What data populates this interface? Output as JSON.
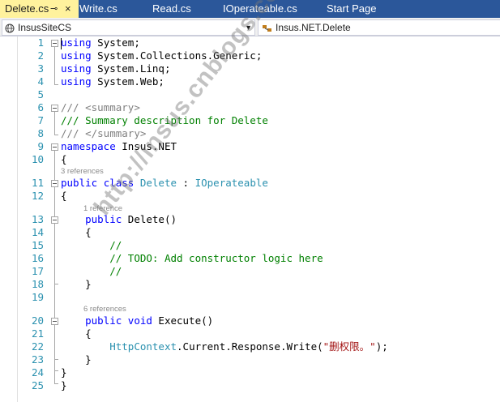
{
  "tabs": [
    {
      "label": "Delete.cs",
      "active": true,
      "pin": "⊸",
      "close": "×"
    },
    {
      "label": "Write.cs"
    },
    {
      "label": "Read.cs"
    },
    {
      "label": "IOperateable.cs"
    },
    {
      "label": "Start Page"
    }
  ],
  "nav": {
    "project": "InsusSiteCS",
    "type": "Insus.NET.Delete"
  },
  "colors": {
    "keyword": "#0000ff",
    "comment": "#008000",
    "type": "#2b91af",
    "string": "#a31515",
    "linenumber": "#2b91af",
    "accent_tab": "#2b579a",
    "active_tab": "#fff29d"
  },
  "lens": {
    "class_refs": "3 references",
    "ctor_refs": "1 reference",
    "method_refs": "6 references"
  },
  "lines": [
    {
      "n": "1",
      "indent": "",
      "tokens": [
        {
          "t": "using",
          "c": "kw"
        },
        {
          "t": " System;",
          "c": "plain"
        }
      ]
    },
    {
      "n": "2",
      "indent": "",
      "tokens": [
        {
          "t": "using",
          "c": "kw"
        },
        {
          "t": " System.Collections.Generic;",
          "c": "plain"
        }
      ]
    },
    {
      "n": "3",
      "indent": "",
      "tokens": [
        {
          "t": "using",
          "c": "kw"
        },
        {
          "t": " System.Linq;",
          "c": "plain"
        }
      ]
    },
    {
      "n": "4",
      "indent": "",
      "tokens": [
        {
          "t": "using",
          "c": "kw"
        },
        {
          "t": " System.Web;",
          "c": "plain"
        }
      ]
    },
    {
      "n": "5",
      "indent": "",
      "tokens": []
    },
    {
      "n": "6",
      "indent": "",
      "tokens": [
        {
          "t": "/// ",
          "c": "doc"
        },
        {
          "t": "<summary>",
          "c": "doctag"
        }
      ]
    },
    {
      "n": "7",
      "indent": "",
      "tokens": [
        {
          "t": "/// Summary description for Delete",
          "c": "cm"
        }
      ]
    },
    {
      "n": "8",
      "indent": "",
      "tokens": [
        {
          "t": "/// ",
          "c": "doc"
        },
        {
          "t": "</summary>",
          "c": "doctag"
        }
      ]
    },
    {
      "n": "9",
      "indent": "",
      "tokens": [
        {
          "t": "namespace",
          "c": "kw"
        },
        {
          "t": " Insus.NET",
          "c": "plain"
        }
      ]
    },
    {
      "n": "10",
      "indent": "",
      "tokens": [
        {
          "t": "{",
          "c": "plain"
        }
      ]
    },
    {
      "n": "11",
      "indent": "",
      "tokens": [
        {
          "t": "public",
          "c": "kw"
        },
        {
          "t": " ",
          "c": "plain"
        },
        {
          "t": "class",
          "c": "kw"
        },
        {
          "t": " ",
          "c": "plain"
        },
        {
          "t": "Delete",
          "c": "ty"
        },
        {
          "t": " : ",
          "c": "plain"
        },
        {
          "t": "IOperateable",
          "c": "ty"
        }
      ]
    },
    {
      "n": "12",
      "indent": "",
      "tokens": [
        {
          "t": "{",
          "c": "plain"
        }
      ]
    },
    {
      "n": "13",
      "indent": "    ",
      "tokens": [
        {
          "t": "public",
          "c": "kw"
        },
        {
          "t": " Delete()",
          "c": "plain"
        }
      ]
    },
    {
      "n": "14",
      "indent": "    ",
      "tokens": [
        {
          "t": "{",
          "c": "plain"
        }
      ]
    },
    {
      "n": "15",
      "indent": "        ",
      "tokens": [
        {
          "t": "//",
          "c": "cm"
        }
      ]
    },
    {
      "n": "16",
      "indent": "        ",
      "tokens": [
        {
          "t": "// TODO: Add constructor logic here",
          "c": "cm"
        }
      ]
    },
    {
      "n": "17",
      "indent": "        ",
      "tokens": [
        {
          "t": "//",
          "c": "cm"
        }
      ]
    },
    {
      "n": "18",
      "indent": "    ",
      "tokens": [
        {
          "t": "}",
          "c": "plain"
        }
      ]
    },
    {
      "n": "19",
      "indent": "",
      "tokens": []
    },
    {
      "n": "20",
      "indent": "    ",
      "tokens": [
        {
          "t": "public",
          "c": "kw"
        },
        {
          "t": " ",
          "c": "plain"
        },
        {
          "t": "void",
          "c": "kw"
        },
        {
          "t": " Execute()",
          "c": "plain"
        }
      ]
    },
    {
      "n": "21",
      "indent": "    ",
      "tokens": [
        {
          "t": "{",
          "c": "plain"
        }
      ]
    },
    {
      "n": "22",
      "indent": "        ",
      "tokens": [
        {
          "t": "HttpContext",
          "c": "ty"
        },
        {
          "t": ".Current.Response.Write(",
          "c": "plain"
        },
        {
          "t": "\"删权限。\"",
          "c": "st"
        },
        {
          "t": ");",
          "c": "plain"
        }
      ]
    },
    {
      "n": "23",
      "indent": "    ",
      "tokens": [
        {
          "t": "}",
          "c": "plain"
        }
      ]
    },
    {
      "n": "24",
      "indent": "",
      "tokens": [
        {
          "t": "}",
          "c": "plain"
        }
      ]
    },
    {
      "n": "25",
      "indent": "",
      "tokens": [
        {
          "t": "}",
          "c": "plain"
        }
      ]
    }
  ],
  "watermark": "http://insus.cnblogs.com"
}
